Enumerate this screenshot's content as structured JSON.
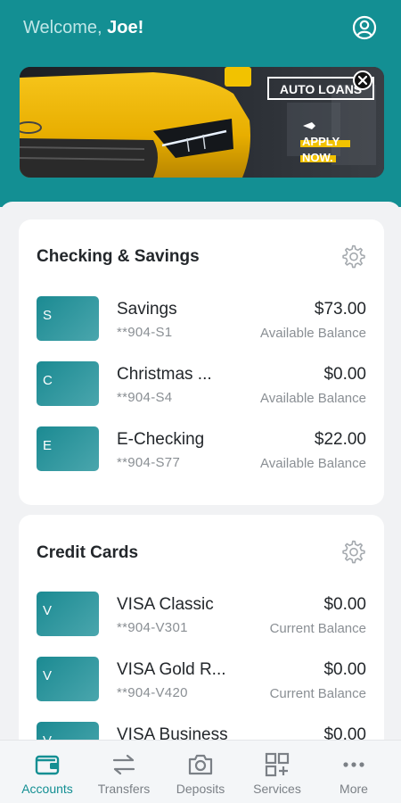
{
  "header": {
    "welcome_prefix": "Welcome,",
    "welcome_name": "Joe!"
  },
  "banner": {
    "title": "AUTO LOANS",
    "cta_line1": "APPLY",
    "cta_line2": "NOW."
  },
  "checking_savings": {
    "title": "Checking & Savings",
    "accounts": [
      {
        "letter": "S",
        "name": "Savings",
        "number": "**904-S1",
        "amount": "$73.00",
        "balance_label": "Available Balance"
      },
      {
        "letter": "C",
        "name": "Christmas ...",
        "number": "**904-S4",
        "amount": "$0.00",
        "balance_label": "Available Balance"
      },
      {
        "letter": "E",
        "name": "E-Checking",
        "number": "**904-S77",
        "amount": "$22.00",
        "balance_label": "Available Balance"
      }
    ]
  },
  "credit_cards": {
    "title": "Credit Cards",
    "accounts": [
      {
        "letter": "V",
        "name": "VISA Classic",
        "number": "**904-V301",
        "amount": "$0.00",
        "balance_label": "Current Balance"
      },
      {
        "letter": "V",
        "name": "VISA Gold R...",
        "number": "**904-V420",
        "amount": "$0.00",
        "balance_label": "Current Balance"
      },
      {
        "letter": "V",
        "name": "VISA Business",
        "number": "",
        "amount": "$0.00",
        "balance_label": ""
      }
    ]
  },
  "nav": {
    "items": [
      {
        "label": "Accounts",
        "icon": "wallet-icon",
        "active": true
      },
      {
        "label": "Transfers",
        "icon": "transfer-arrows-icon",
        "active": false
      },
      {
        "label": "Deposits",
        "icon": "camera-icon",
        "active": false
      },
      {
        "label": "Services",
        "icon": "grid-plus-icon",
        "active": false
      },
      {
        "label": "More",
        "icon": "more-dots-icon",
        "active": false
      }
    ]
  },
  "colors": {
    "brand": "#138f93",
    "accent_yellow": "#f2c200"
  }
}
